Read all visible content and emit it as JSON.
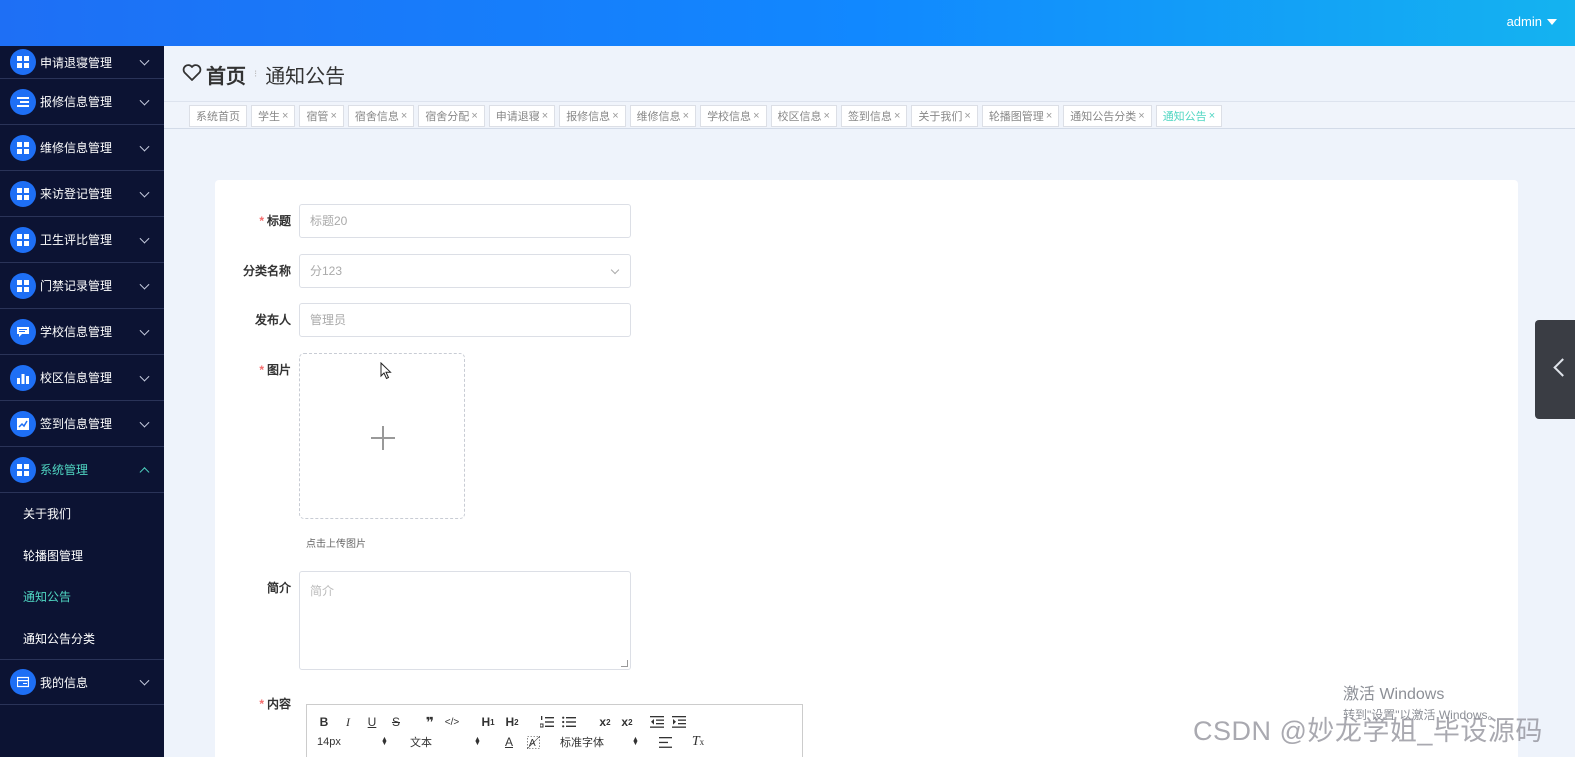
{
  "topbar": {
    "user": "admin"
  },
  "sidebar": {
    "menus": [
      {
        "label": "申请退寝管理"
      },
      {
        "label": "报修信息管理"
      },
      {
        "label": "维修信息管理"
      },
      {
        "label": "来访登记管理"
      },
      {
        "label": "卫生评比管理"
      },
      {
        "label": "门禁记录管理"
      },
      {
        "label": "学校信息管理"
      },
      {
        "label": "校区信息管理"
      },
      {
        "label": "签到信息管理"
      },
      {
        "label": "系统管理"
      }
    ],
    "submenu": [
      {
        "label": "关于我们"
      },
      {
        "label": "轮播图管理"
      },
      {
        "label": "通知公告"
      },
      {
        "label": "通知公告分类"
      }
    ],
    "last": {
      "label": "我的信息"
    }
  },
  "breadcrumb": {
    "home": "首页",
    "current": "通知公告"
  },
  "tabs": [
    "系统首页",
    "学生",
    "宿管",
    "宿舍信息",
    "宿舍分配",
    "申请退寝",
    "报修信息",
    "维修信息",
    "学校信息",
    "校区信息",
    "签到信息",
    "关于我们",
    "轮播图管理",
    "通知公告分类",
    "通知公告"
  ],
  "form": {
    "title": {
      "label": "标题",
      "value": "标题20"
    },
    "category": {
      "label": "分类名称",
      "value": "分123"
    },
    "publisher": {
      "label": "发布人",
      "value": "管理员"
    },
    "image": {
      "label": "图片",
      "tip": "点击上传图片"
    },
    "intro": {
      "label": "简介",
      "placeholder": "简介"
    },
    "content": {
      "label": "内容"
    }
  },
  "editor": {
    "font_size": "14px",
    "block": "文本",
    "font_family": "标准字体"
  },
  "watermark": {
    "activate_title": "激活 Windows",
    "activate_sub": "转到\"设置\"以激活 Windows。",
    "csdn": "CSDN @妙龙学姐_毕设源码"
  }
}
